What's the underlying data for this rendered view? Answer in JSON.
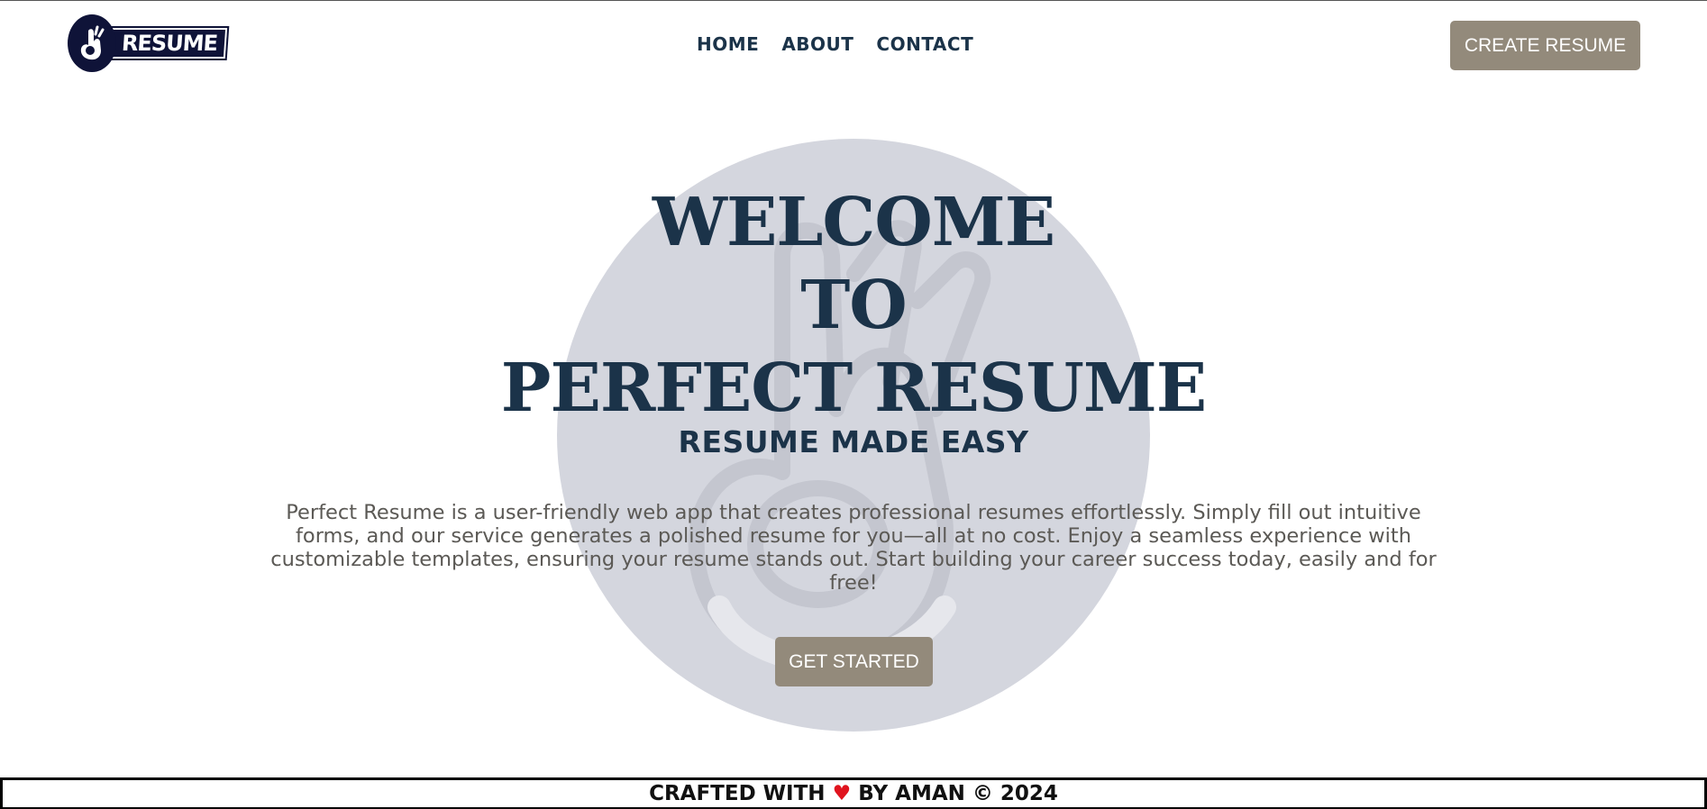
{
  "brand": {
    "logo_text": "RESUME",
    "logo_icon": "ok-hand-icon"
  },
  "nav": {
    "items": [
      {
        "label": "HOME"
      },
      {
        "label": "ABOUT"
      },
      {
        "label": "CONTACT"
      }
    ]
  },
  "header": {
    "cta_label": "CREATE RESUME"
  },
  "hero": {
    "title_lines": [
      "WELCOME",
      "TO",
      "PERFECT RESUME"
    ],
    "subtitle": "RESUME MADE EASY",
    "description": "Perfect Resume is a user-friendly web app that creates professional resumes effortlessly. Simply fill out intuitive forms, and our service generates a polished resume for you—all at no cost. Enjoy a seamless experience with customizable templates, ensuring your resume stands out. Start building your career success today, easily and for free!",
    "cta_label": "GET STARTED",
    "background_icon": "ok-hand-icon"
  },
  "footer": {
    "text_before": "CRAFTED WITH",
    "heart": "♥",
    "text_after": "BY AMAN © 2024"
  },
  "colors": {
    "primary_text": "#1b3349",
    "button_bg": "#938a7b",
    "hero_circle": "#d4d6de",
    "logo_bg": "#0f1338",
    "heart": "#e0141e"
  }
}
